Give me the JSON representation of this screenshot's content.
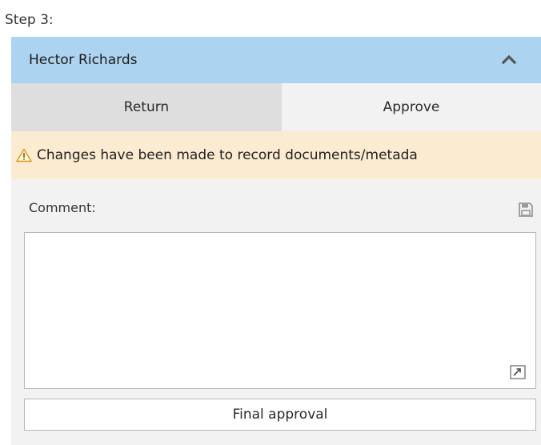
{
  "step": {
    "label": "Step 3:"
  },
  "assignee": {
    "name": "Hector Richards",
    "collapse_icon": "chevron-up-icon",
    "header_color": "#acd3ef"
  },
  "tabs": [
    {
      "label": "Return",
      "selected": true
    },
    {
      "label": "Approve",
      "selected": false
    }
  ],
  "warning": {
    "icon": "warning-icon",
    "text": "Changes have been made to record documents/metada",
    "background": "#fbebd1"
  },
  "comment": {
    "label": "Comment:",
    "value": "",
    "save_icon": "save-icon",
    "expand_icon": "expand-icon"
  },
  "actions": {
    "final_approval_label": "Final approval"
  }
}
